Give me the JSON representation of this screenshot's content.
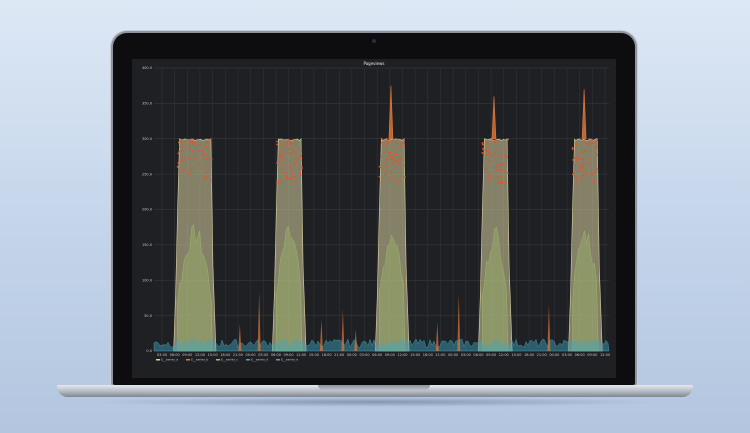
{
  "chart_data": {
    "type": "area",
    "title": "Pageviews",
    "xlabel": "",
    "ylabel": "",
    "ylim": [
      0,
      400
    ],
    "y_ticks": [
      0,
      50,
      100,
      150,
      200,
      250,
      300,
      350,
      400
    ],
    "x_tick_labels": [
      "03:00",
      "06:00",
      "09:00",
      "12:00",
      "15:00",
      "18:00",
      "21:00",
      "00:00",
      "03:00",
      "06:00",
      "09:00",
      "12:00",
      "15:00",
      "18:00",
      "21:00",
      "00:00",
      "03:00",
      "06:00",
      "09:00",
      "12:00",
      "15:00",
      "18:00",
      "21:00",
      "00:00",
      "03:00",
      "06:00",
      "09:00",
      "12:00",
      "15:00",
      "18:00",
      "21:00",
      "00:00",
      "03:00",
      "06:00",
      "09:00",
      "12:00"
    ],
    "grid": true,
    "legend_position": "bottom",
    "peaks": [
      {
        "start": 0.055,
        "end": 0.135,
        "plateau": 300,
        "spike": 300
      },
      {
        "start": 0.285,
        "end": 0.345,
        "plateau": 300,
        "spike": 300
      },
      {
        "start": 0.525,
        "end": 0.585,
        "plateau": 300,
        "spike": 375
      },
      {
        "start": 0.765,
        "end": 0.825,
        "plateau": 300,
        "spike": 360
      },
      {
        "start": 0.975,
        "end": 1.035,
        "plateau": 300,
        "spike": 370
      }
    ],
    "series": [
      {
        "name": "$__series_a",
        "color": "#d8d2a0"
      },
      {
        "name": "$__series_b",
        "color": "#e07a3c"
      },
      {
        "name": "$__series_c",
        "color": "#9fbf6a"
      },
      {
        "name": "$__series_d",
        "color": "#3fa7c2"
      },
      {
        "name": "$__series_e",
        "color": "#6a8fd8"
      }
    ]
  }
}
